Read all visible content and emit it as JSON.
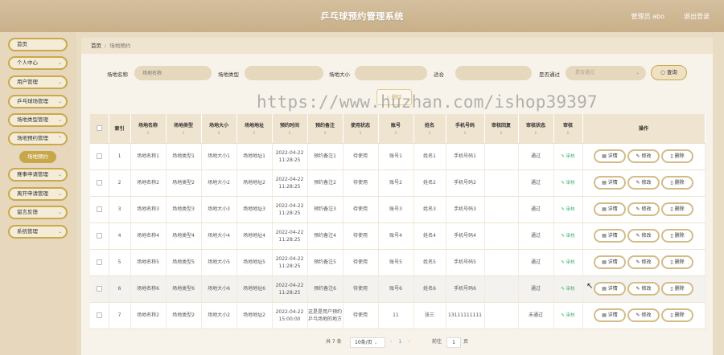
{
  "header": {
    "title": "乒乓球预约管理系统",
    "user": "管理员 abo",
    "logout": "退出登录"
  },
  "sidebar": {
    "items": [
      "首页",
      "个人中心",
      "用户管理",
      "乒乓球场管理",
      "场地类型管理",
      "场地预约管理",
      "赛事申请管理",
      "离开申请管理",
      "留言反馈",
      "系统管理"
    ],
    "sub_item": "场地预约"
  },
  "breadcrumb": {
    "home": "首页",
    "separator": "/",
    "current": "场地预约"
  },
  "filters": {
    "venue_name_label": "场地名称",
    "venue_name_placeholder": "场地名称",
    "venue_type_label": "场地类型",
    "venue_size_label": "场地大小",
    "status_label": "适合",
    "audit_label": "是否通过",
    "audit_value": "是否通过",
    "search_button": "查询"
  },
  "bulk_delete": "删除",
  "watermark": "https://www.huzhan.com/ishop39397",
  "table": {
    "columns": [
      "索引",
      "场地名称",
      "场地类型",
      "场地大小",
      "场地地址",
      "预约时间",
      "预约备注",
      "使用状态",
      "账号",
      "姓名",
      "手机号码",
      "审核回复",
      "审核状态",
      "审核",
      "操作"
    ],
    "audit_link": "审核",
    "actions": {
      "detail": "详情",
      "edit": "修改",
      "delete": "删除"
    },
    "rows": [
      {
        "idx": "1",
        "name": "场地名称1",
        "type": "场地类型1",
        "size": "场地大小1",
        "addr": "场地地址1",
        "time": "2022-04-22 11:28:25",
        "note": "预约备注1",
        "use": "待使用",
        "acct": "账号1",
        "uname": "姓名1",
        "phone": "手机号码1",
        "reply": "",
        "status": "通过"
      },
      {
        "idx": "2",
        "name": "场地名称2",
        "type": "场地类型2",
        "size": "场地大小2",
        "addr": "场地地址2",
        "time": "2022-04-22 11:28:25",
        "note": "预约备注2",
        "use": "待使用",
        "acct": "账号2",
        "uname": "姓名2",
        "phone": "手机号码2",
        "reply": "",
        "status": "通过"
      },
      {
        "idx": "3",
        "name": "场地名称3",
        "type": "场地类型3",
        "size": "场地大小3",
        "addr": "场地地址3",
        "time": "2022-04-22 11:28:25",
        "note": "预约备注3",
        "use": "待使用",
        "acct": "账号3",
        "uname": "姓名3",
        "phone": "手机号码3",
        "reply": "",
        "status": "通过"
      },
      {
        "idx": "4",
        "name": "场地名称4",
        "type": "场地类型4",
        "size": "场地大小4",
        "addr": "场地地址4",
        "time": "2022-04-22 11:28:25",
        "note": "预约备注4",
        "use": "待使用",
        "acct": "账号4",
        "uname": "姓名4",
        "phone": "手机号码4",
        "reply": "",
        "status": "通过"
      },
      {
        "idx": "5",
        "name": "场地名称5",
        "type": "场地类型5",
        "size": "场地大小5",
        "addr": "场地地址5",
        "time": "2022-04-22 11:28:25",
        "note": "预约备注5",
        "use": "待使用",
        "acct": "账号5",
        "uname": "姓名5",
        "phone": "手机号码5",
        "reply": "",
        "status": "通过"
      },
      {
        "idx": "6",
        "name": "场地名称6",
        "type": "场地类型6",
        "size": "场地大小6",
        "addr": "场地地址6",
        "time": "2022-04-22 11:28:25",
        "note": "预约备注6",
        "use": "待使用",
        "acct": "账号6",
        "uname": "姓名6",
        "phone": "手机号码6",
        "reply": "",
        "status": "通过"
      },
      {
        "idx": "7",
        "name": "场地名称2",
        "type": "场地类型2",
        "size": "场地大小2",
        "addr": "场地地址2",
        "time": "2022-04-22 15:00:00",
        "note": "这是是用户预约乒乓场地的地方",
        "use": "待使用",
        "acct": "11",
        "uname": "张三",
        "phone": "13111111111",
        "reply": "",
        "status": "未通过"
      }
    ]
  },
  "pagination": {
    "total": "共 7 条",
    "page_size": "10条/页",
    "prev": "‹",
    "page": "1",
    "next": "›",
    "goto_label": "前往",
    "goto_value": "1",
    "page_unit": "页"
  },
  "colors": {
    "accent": "#c9a94a",
    "header": "#cdb58f",
    "audit_green": "#3cb371"
  }
}
